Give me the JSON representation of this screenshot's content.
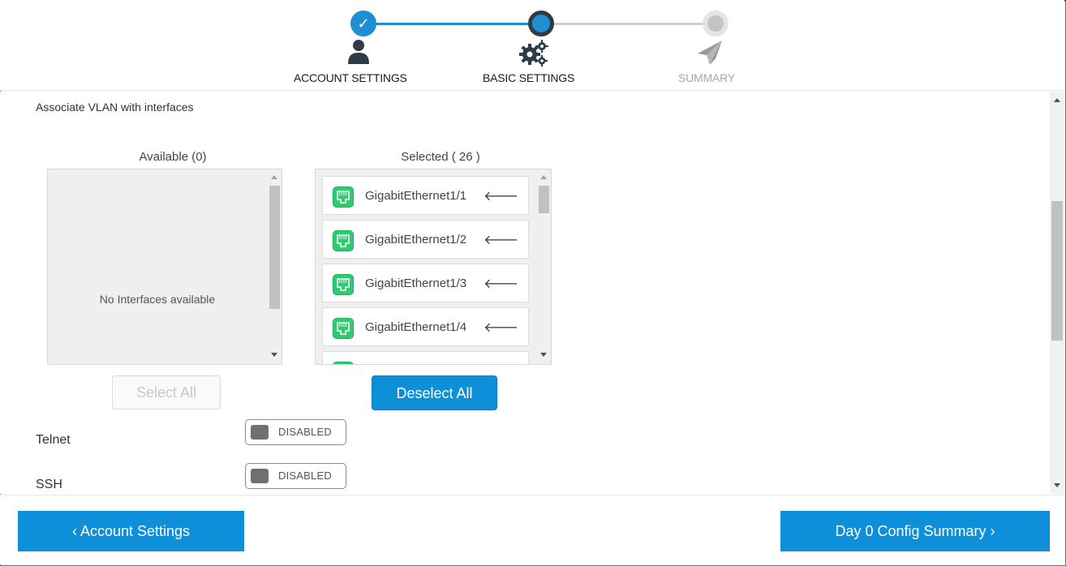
{
  "wizard": {
    "steps": [
      {
        "label": "ACCOUNT SETTINGS",
        "state": "complete",
        "check": "✓"
      },
      {
        "label": "BASIC SETTINGS",
        "state": "current"
      },
      {
        "label": "SUMMARY",
        "state": "upcoming"
      }
    ]
  },
  "vlan": {
    "section_title": "Associate VLAN with interfaces",
    "available_label": "Available (0)",
    "selected_label": "Selected ( 26 )",
    "empty_message": "No Interfaces available",
    "selected_interfaces": [
      "GigabitEthernet1/1",
      "GigabitEthernet1/2",
      "GigabitEthernet1/3",
      "GigabitEthernet1/4"
    ],
    "remove_arrow": "🡐",
    "select_all_label": "Select All",
    "deselect_all_label": "Deselect All"
  },
  "services": {
    "telnet": {
      "label": "Telnet",
      "state": "DISABLED"
    },
    "ssh": {
      "label": "SSH",
      "state": "DISABLED"
    }
  },
  "footer": {
    "prev_label": "‹ Account Settings",
    "next_label": "Day 0 Config Summary ›"
  },
  "colors": {
    "accent": "#0d8fd9",
    "port_green": "#2ecc71",
    "current_step_ring": "#2f3c48",
    "inactive": "#a8a8a8"
  },
  "icons": {
    "step1": "user-icon",
    "step2": "gears-icon",
    "step3": "paper-plane-icon",
    "port": "ethernet-port-icon",
    "remove": "arrow-left-icon"
  }
}
